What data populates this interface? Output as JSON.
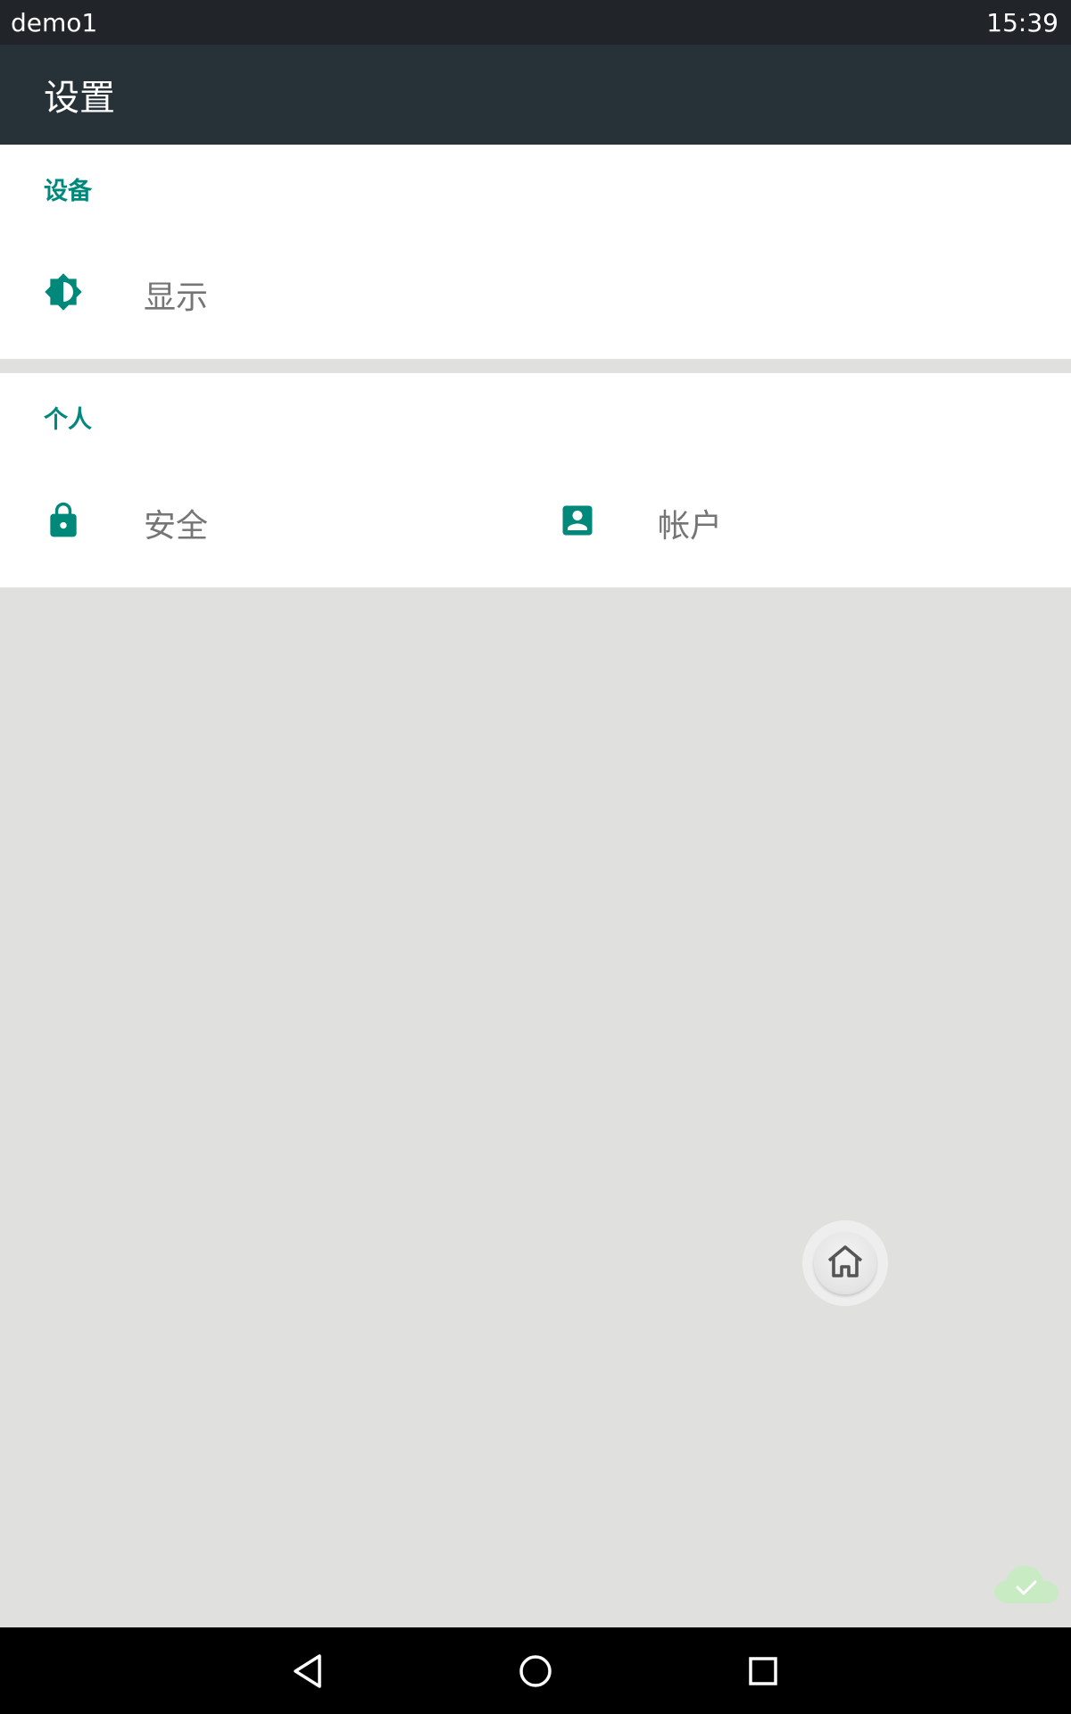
{
  "status_bar": {
    "app_name": "demo1",
    "time": "15:39"
  },
  "app_bar": {
    "title": "设置"
  },
  "sections": [
    {
      "title": "设备",
      "items": [
        {
          "label": "显示",
          "icon": "brightness-icon"
        }
      ]
    },
    {
      "title": "个人",
      "items": [
        {
          "label": "安全",
          "icon": "lock-icon"
        },
        {
          "label": "帐户",
          "icon": "account-box-icon"
        }
      ]
    }
  ],
  "colors": {
    "accent": "#00897b",
    "app_bar": "#263238",
    "status_bar": "#212529",
    "background": "#e0e0df"
  },
  "nav_bar": {
    "buttons": [
      "back-icon",
      "home-circle-icon",
      "recent-apps-icon"
    ]
  },
  "floating": {
    "icon": "house-icon"
  }
}
